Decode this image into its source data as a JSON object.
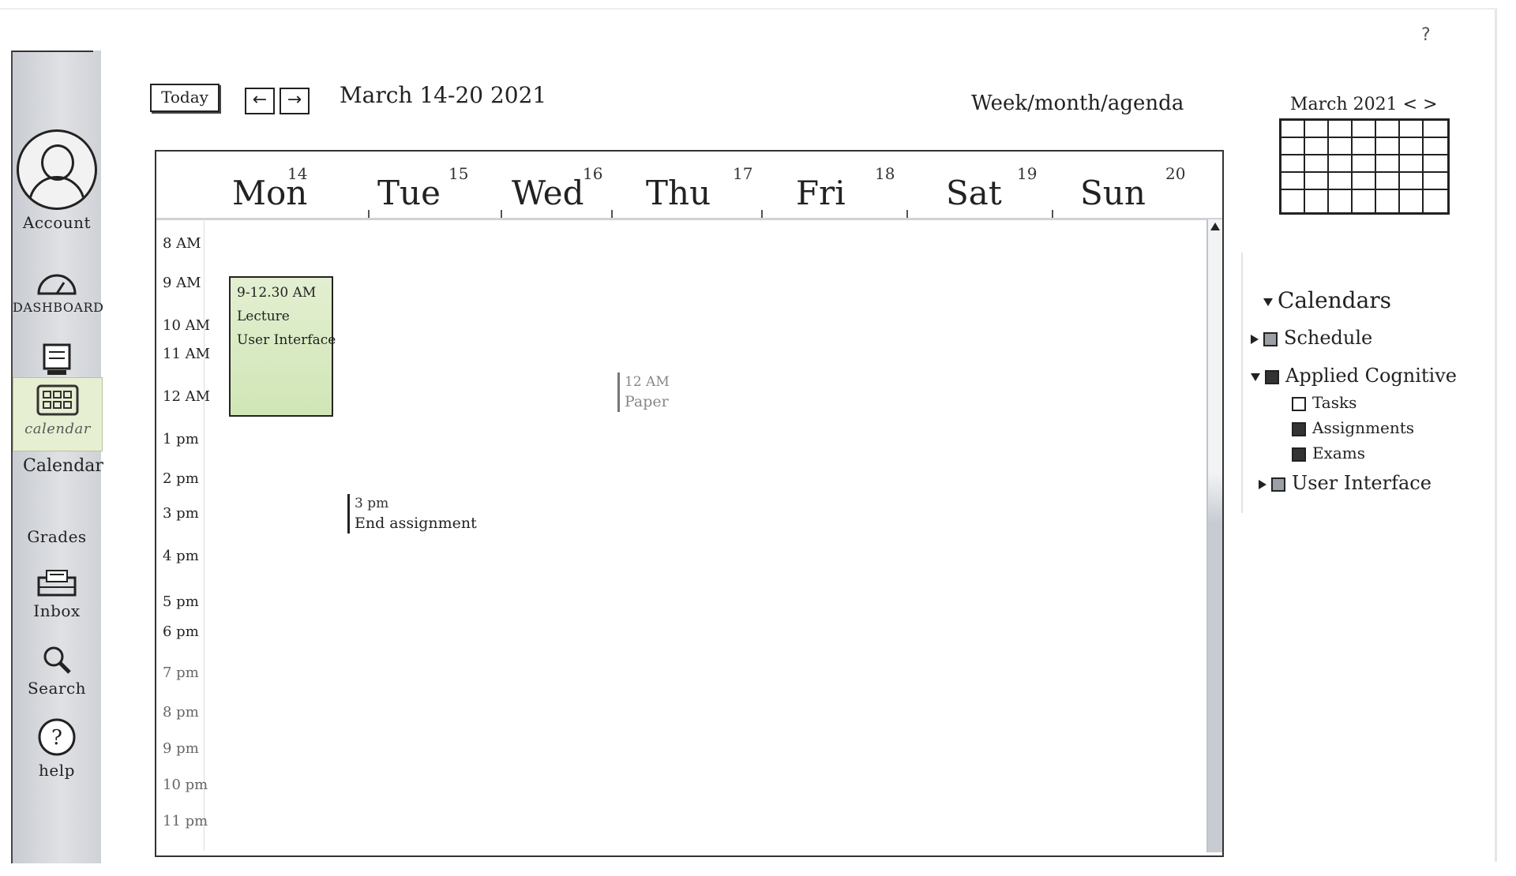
{
  "toolbar": {
    "today_label": "Today",
    "prev_icon": "arrow-left-icon",
    "next_icon": "arrow-right-icon",
    "date_range": "March 14-20 2021",
    "view_switch": "Week/month/agenda",
    "help_mark": "?"
  },
  "sidebar": {
    "account_label": "Account",
    "dashboard_label": "DASHBOARD",
    "courses_icon": "book-icon",
    "calendar_label": "calendar",
    "calendar_caption": "Calendar",
    "grades_label": "Grades",
    "inbox_label": "Inbox",
    "search_label": "Search",
    "help_label": "help"
  },
  "week": {
    "days": [
      {
        "name": "Mon",
        "num": "14"
      },
      {
        "name": "Tue",
        "num": "15"
      },
      {
        "name": "Wed",
        "num": "16"
      },
      {
        "name": "Thu",
        "num": "17"
      },
      {
        "name": "Fri",
        "num": "18"
      },
      {
        "name": "Sat",
        "num": "19"
      },
      {
        "name": "Sun",
        "num": "20"
      }
    ],
    "hours": [
      "8 AM",
      "9 AM",
      "10 AM",
      "11 AM",
      "12 AM",
      "1 pm",
      "2 pm",
      "3 pm",
      "4 pm",
      "5 pm",
      "6 pm",
      "7 pm",
      "8 pm",
      "9 pm",
      "10 pm",
      "11 pm"
    ]
  },
  "events": {
    "lecture": {
      "time": "9-12.30 AM",
      "title": "Lecture",
      "course": "User Interface",
      "color": "#d0e6b6"
    },
    "paper": {
      "time": "12 AM",
      "title": "Paper"
    },
    "assignment": {
      "time": "3 pm",
      "title": "End assignment"
    }
  },
  "mini_calendar": {
    "title": "March 2021",
    "prev": "<",
    "next": ">"
  },
  "calendars": {
    "heading": "Calendars",
    "items": [
      {
        "label": "Schedule"
      },
      {
        "label": "Applied Cognitive"
      },
      {
        "label": "Tasks"
      },
      {
        "label": "Assignments"
      },
      {
        "label": "Exams"
      },
      {
        "label": "User Interface"
      }
    ]
  }
}
